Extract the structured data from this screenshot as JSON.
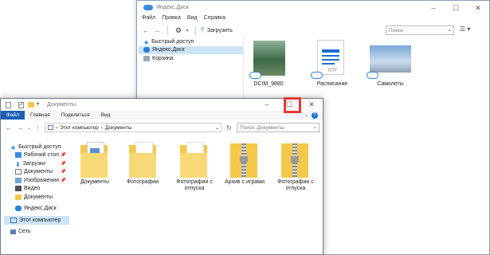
{
  "yd": {
    "title": "Яндекс.Диск",
    "menu": [
      "Файл",
      "Правка",
      "Вид",
      "Справка"
    ],
    "upload_label": "Загрузить",
    "search_placeholder": "Поиск",
    "nav": [
      "Быстрый доступ",
      "Яндекс.Диск",
      "Корзина"
    ],
    "items": [
      "DCIM_9880",
      "Расписание",
      "Самолеты"
    ],
    "rtf_label": "RTF"
  },
  "ex": {
    "title": "Документы",
    "ribbon": [
      "Файл",
      "Главная",
      "Поделиться",
      "Вид"
    ],
    "path": [
      "Этот компьютер",
      "Документы"
    ],
    "search_placeholder": "Поиск: Документы",
    "nav": [
      "Быстрый доступ",
      "Рабочий стол",
      "Загрузки",
      "Документы",
      "Изображения",
      "Видео",
      "Документы",
      "Яндекс.Диск",
      "Этот компьютер",
      "Сеть"
    ],
    "items": [
      "Документы",
      "Фотографии",
      "Фотографии с отпуска",
      "Архив с играми",
      "Фотографии с отпуска"
    ]
  },
  "colors": {
    "accent": "#1e5fb6",
    "highlight": "#e53935",
    "cloud": "#2d7fd3",
    "folder": "#f3c84b"
  },
  "icons": [
    "back-arrow-icon",
    "forward-arrow-icon",
    "gear-icon",
    "upload-icon",
    "search-icon",
    "minimize-icon",
    "maximize-icon",
    "close-icon",
    "folder-icon",
    "zip-folder-icon",
    "cloud-icon",
    "help-icon"
  ]
}
